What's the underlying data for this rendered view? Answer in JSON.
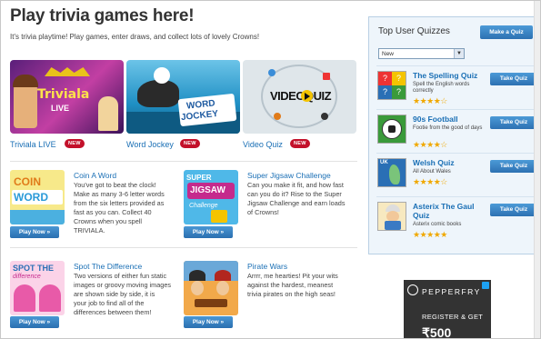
{
  "header": {
    "title": "Play trivia games here!",
    "subtitle": "It's trivia playtime! Play games, enter draws, and collect lots of lovely Crowns!"
  },
  "features": [
    {
      "label": "Triviala LIVE",
      "badge": "NEW"
    },
    {
      "label": "Word Jockey",
      "badge": "NEW"
    },
    {
      "label": "Video Quiz",
      "badge": "NEW"
    }
  ],
  "games": [
    {
      "title": "Coin A Word",
      "desc_lines": [
        "You've got to beat the clock!",
        "Make as many 3-6 letter words",
        "from the six letters provided as",
        "fast as you can. Collect 40",
        "Crowns when you spell",
        "TRIVIALA."
      ],
      "play_label": "Play Now »"
    },
    {
      "title": "Super Jigsaw Challenge",
      "desc_lines": [
        "Can you make it fit, and how fast",
        "can you do it? Rise to the Super",
        "Jigsaw Challenge and earn loads",
        "of Crowns!"
      ],
      "play_label": "Play Now »"
    },
    {
      "title": "Spot The Difference",
      "desc_lines": [
        "Two versions of either fun static",
        "images or groovy moving images",
        "are shown side by side, it is",
        "your job to find all of the",
        "differences between them!"
      ],
      "play_label": "Play Now »"
    },
    {
      "title": "Pirate Wars",
      "desc_lines": [
        "Arrrr, me hearties! Pit your wits",
        "against the hardest, meanest",
        "trivia pirates on the high seas!"
      ],
      "play_label": "Play Now »"
    }
  ],
  "sidebar": {
    "title": "Top User Quizzes",
    "make_quiz_label": "Make a Quiz",
    "filter_value": "New",
    "quizzes": [
      {
        "title": "The Spelling Quiz",
        "desc": "Spell the English words correctly",
        "stars": "★★★★☆",
        "button": "Take Quiz"
      },
      {
        "title": "90s Football",
        "desc": "Footie from the good of days",
        "stars": "★★★★☆",
        "button": "Take Quiz"
      },
      {
        "title": "Welsh Quiz",
        "desc": "All About Wales",
        "stars": "★★★★☆",
        "button": "Take Quiz"
      },
      {
        "title": "Asterix The Gaul Quiz",
        "desc": "Asterix comic books",
        "stars": "★★★★★",
        "button": "Take Quiz"
      }
    ]
  },
  "ad": {
    "brand": "PEPPERFRY",
    "cta": "REGISTER & GET",
    "amount": "₹500"
  },
  "colors": {
    "link_blue": "#1a6fb5",
    "button_blue": "#2d71b2",
    "badge_red": "#c3102a",
    "star_gold": "#f0a800"
  }
}
